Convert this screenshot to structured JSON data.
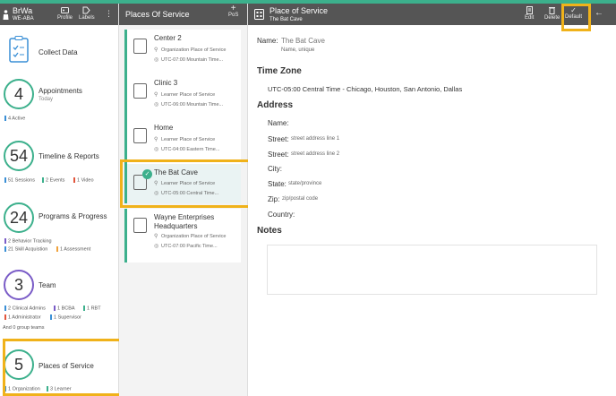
{
  "app": {
    "brand": "BrWa",
    "org": "WE-ABA",
    "profile_label": "Profile",
    "labels_label": "Labels"
  },
  "left_cards": [
    {
      "title": "Collect Data"
    },
    {
      "count": "4",
      "title": "Appointments",
      "subtitle": "Today",
      "stats": [
        "4 Active"
      ]
    },
    {
      "count": "54",
      "title": "Timeline & Reports",
      "stats": [
        "51 Sessions",
        "2 Events",
        "1 Video"
      ]
    },
    {
      "count": "24",
      "title": "Programs & Progress",
      "stats": [
        "2 Behavior Tracking",
        "21 Skill Acquistion",
        "1 Assessment"
      ]
    },
    {
      "count": "3",
      "title": "Team",
      "stats": [
        "2 Clinical Admins",
        "1 BCBA",
        "1 RBT",
        "1 Administrator",
        "1 Supervisor"
      ],
      "extra": "And 0 group teams"
    },
    {
      "count": "5",
      "title": "Places of Service",
      "stats": [
        "1 Organization",
        "3 Learner"
      ]
    }
  ],
  "places": {
    "header": "Places Of Service",
    "add_label": "PoS",
    "items": [
      {
        "name": "Center 2",
        "type": "Organization Place of Service",
        "tz": "UTC-07:00 Mountain Time..."
      },
      {
        "name": "Clinic 3",
        "type": "Learner Place of Service",
        "tz": "UTC-06:00 Mountain Time..."
      },
      {
        "name": "Home",
        "type": "Learner Place of Service",
        "tz": "UTC-04:00 Eastern Time..."
      },
      {
        "name": "The Bat Cave",
        "type": "Learner Place of Service",
        "tz": "UTC-05:00 Central Time..."
      },
      {
        "name": "Wayne Enterprises Headquarters",
        "type": "Organization Place of Service",
        "tz": "UTC-07:00 Pacific Time..."
      }
    ]
  },
  "detail": {
    "header_title": "Place of Service",
    "header_sub": "The Bat Cave",
    "edit_label": "Edit",
    "delete_label": "Delete",
    "default_label": "Default",
    "name_label": "Name:",
    "name_value": "The Bat Cave",
    "name_hint": "Name, unique",
    "tz_heading": "Time Zone",
    "tz_value": "UTC-05:00 Central Time - Chicago, Houston, San Antonio, Dallas",
    "address_heading": "Address",
    "fields": [
      {
        "label": "Name:",
        "value": ""
      },
      {
        "label": "Street:",
        "value": "street address line 1"
      },
      {
        "label": "Street:",
        "value": "street address line 2"
      },
      {
        "label": "City:",
        "value": ""
      },
      {
        "label": "State:",
        "value": "state/province"
      },
      {
        "label": "Zip:",
        "value": "zip/postal code"
      },
      {
        "label": "Country:",
        "value": ""
      }
    ],
    "notes_heading": "Notes"
  },
  "colors": {
    "accent": "#3cb08c",
    "header": "#555555",
    "highlight": "#f0b21a"
  }
}
